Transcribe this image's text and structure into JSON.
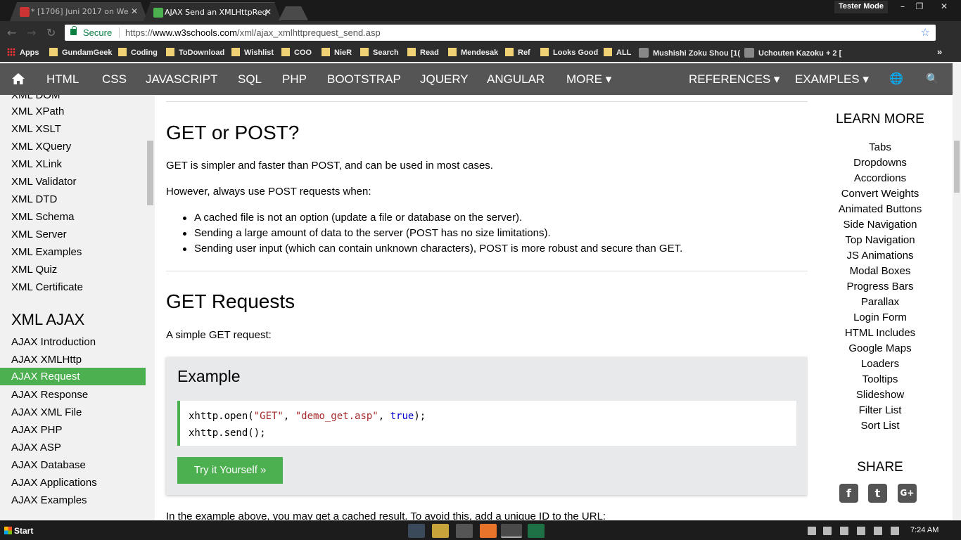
{
  "browser": {
    "tabs": [
      {
        "title": "* [1706] Juni 2017 on We",
        "active": false
      },
      {
        "title": "AJAX Send an XMLHttpReq",
        "active": true
      }
    ],
    "user_mode": "Tester Mode",
    "window_controls": {
      "minimize": "–",
      "maximize": "❐",
      "close": "✕"
    },
    "secure_label": "Secure",
    "url_scheme": "https://",
    "url_host": "www.w3schools.com",
    "url_path": "/xml/ajax_xmlhttprequest_send.asp",
    "bookmarks": [
      "Apps",
      "GundamGeek",
      "Coding",
      "ToDownload",
      "Wishlist",
      "COO",
      "NieR",
      "Search",
      "Read",
      "Mendesak",
      "Ref",
      "Looks Good",
      "ALL",
      "Mushishi Zoku Shou [1(",
      "Uchouten Kazoku + 2 ["
    ],
    "bookmarks_overflow": "»"
  },
  "topnav": {
    "items": [
      "HTML",
      "CSS",
      "JAVASCRIPT",
      "SQL",
      "PHP",
      "BOOTSTRAP",
      "JQUERY",
      "ANGULAR",
      "MORE ▾"
    ],
    "right_items": [
      "REFERENCES ▾",
      "EXAMPLES ▾"
    ],
    "globe_icon": "🌐",
    "search_icon": "🔍"
  },
  "sidebar": {
    "top_partial": "XML DOM",
    "links": [
      "XML XPath",
      "XML XSLT",
      "XML XQuery",
      "XML XLink",
      "XML Validator",
      "XML DTD",
      "XML Schema",
      "XML Server",
      "XML Examples",
      "XML Quiz",
      "XML Certificate"
    ],
    "section_heading": "XML AJAX",
    "ajax_links": [
      "AJAX Introduction",
      "AJAX XMLHttp",
      "AJAX Request",
      "AJAX Response",
      "AJAX XML File",
      "AJAX PHP",
      "AJAX ASP",
      "AJAX Database",
      "AJAX Applications",
      "AJAX Examples"
    ],
    "active": "AJAX Request"
  },
  "main": {
    "h_getpost": "GET or POST?",
    "p1": "GET is simpler and faster than POST, and can be used in most cases.",
    "p2": "However, always use POST requests when:",
    "bullets": [
      "A cached file is not an option (update a file or database on the server).",
      "Sending a large amount of data to the server (POST has no size limitations).",
      "Sending user input (which can contain unknown characters), POST is more robust and secure than GET."
    ],
    "h_get": "GET Requests",
    "p3": "A simple GET request:",
    "example_title": "Example",
    "code": {
      "l1a": "xhttp.open(",
      "l1b": "\"GET\"",
      "l1c": ", ",
      "l1d": "\"demo_get.asp\"",
      "l1e": ", ",
      "l1f": "true",
      "l1g": ");",
      "l2": "xhttp.send();"
    },
    "try_button": "Try it Yourself »",
    "p4": "In the example above, you may get a cached result. To avoid this, add a unique ID to the URL:"
  },
  "right": {
    "learn_more": "LEARN MORE",
    "links": [
      "Tabs",
      "Dropdowns",
      "Accordions",
      "Convert Weights",
      "Animated Buttons",
      "Side Navigation",
      "Top Navigation",
      "JS Animations",
      "Modal Boxes",
      "Progress Bars",
      "Parallax",
      "Login Form",
      "HTML Includes",
      "Google Maps",
      "Loaders",
      "Tooltips",
      "Slideshow",
      "Filter List",
      "Sort List"
    ],
    "share": "SHARE",
    "share_icons": [
      "f",
      "t",
      "G+"
    ]
  },
  "taskbar": {
    "start": "Start",
    "time": "7:24 AM"
  }
}
